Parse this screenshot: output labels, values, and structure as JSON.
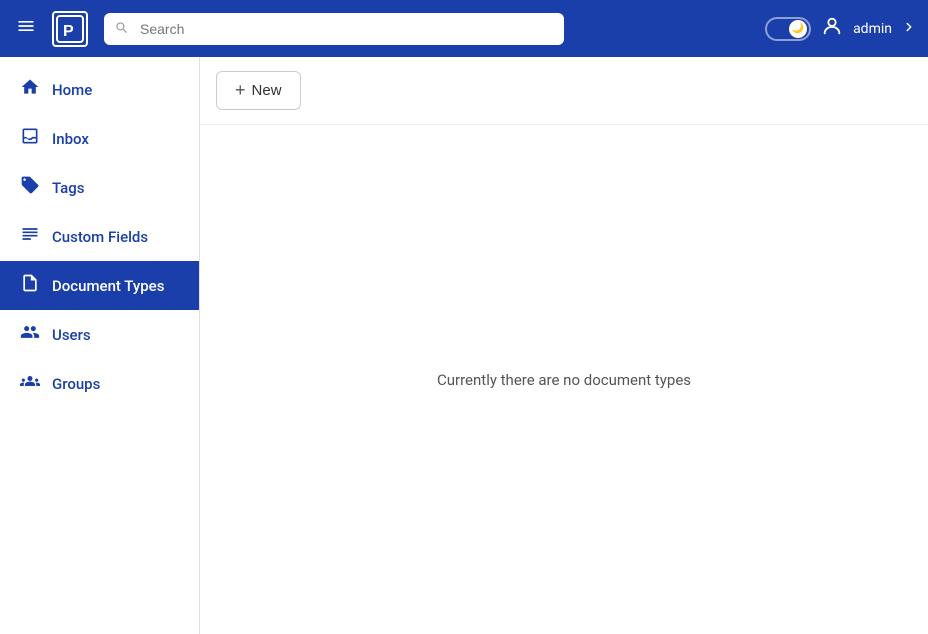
{
  "header": {
    "menu_icon": "☰",
    "logo_text": "P",
    "search_placeholder": "Search",
    "username": "admin",
    "toggle_on": true
  },
  "sidebar": {
    "items": [
      {
        "id": "home",
        "label": "Home",
        "active": false
      },
      {
        "id": "inbox",
        "label": "Inbox",
        "active": false
      },
      {
        "id": "tags",
        "label": "Tags",
        "active": false
      },
      {
        "id": "custom-fields",
        "label": "Custom Fields",
        "active": false
      },
      {
        "id": "document-types",
        "label": "Document Types",
        "active": true
      },
      {
        "id": "users",
        "label": "Users",
        "active": false
      },
      {
        "id": "groups",
        "label": "Groups",
        "active": false
      }
    ]
  },
  "toolbar": {
    "new_label": "New"
  },
  "content": {
    "empty_message": "Currently there are no document types"
  }
}
